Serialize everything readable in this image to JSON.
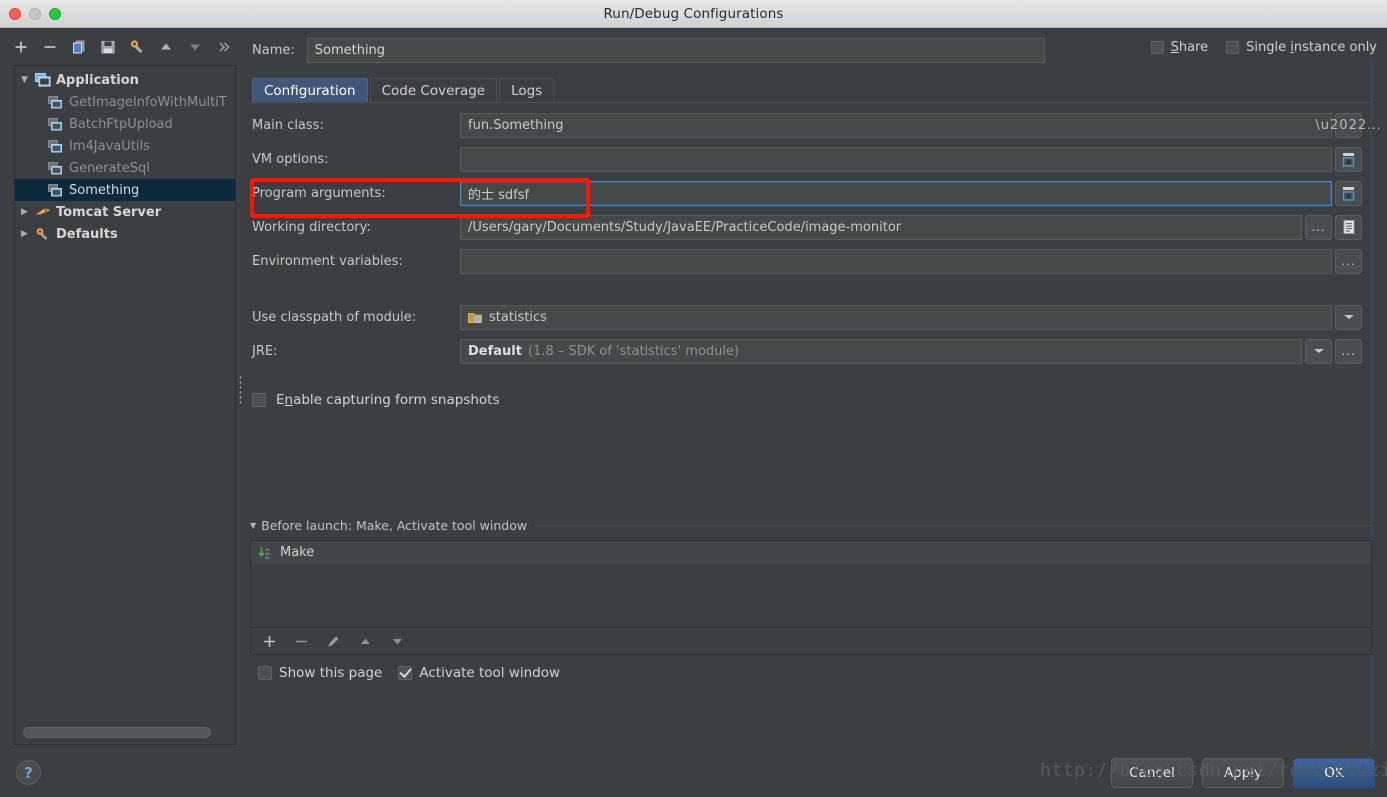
{
  "window": {
    "title": "Run/Debug Configurations",
    "traffic_lights": [
      "close",
      "minimize",
      "zoom"
    ]
  },
  "left_toolbar": {
    "items": [
      {
        "icon": "plus-icon",
        "label": "+"
      },
      {
        "icon": "minus-icon",
        "label": "−"
      },
      {
        "icon": "copy-icon",
        "label": "Copy"
      },
      {
        "icon": "save-icon",
        "label": "Save"
      },
      {
        "icon": "settings-wrench-icon",
        "label": "Edit defaults"
      },
      {
        "icon": "move-up-icon",
        "label": "Move Up"
      },
      {
        "icon": "move-down-icon",
        "label": "Move Down"
      },
      {
        "icon": "chevron-double-right-icon",
        "label": "»"
      }
    ]
  },
  "tree": {
    "nodes": [
      {
        "label": "Application",
        "level": 0,
        "expanded": true,
        "icon": "application-icon",
        "selected": false
      },
      {
        "label": "GetImageInfoWithMultiT",
        "level": 1,
        "icon": "run-config-icon",
        "selected": false
      },
      {
        "label": "BatchFtpUpload",
        "level": 1,
        "icon": "run-config-icon",
        "selected": false
      },
      {
        "label": "Im4JavaUtils",
        "level": 1,
        "icon": "run-config-icon",
        "selected": false
      },
      {
        "label": "GenerateSql",
        "level": 1,
        "icon": "run-config-icon",
        "selected": false
      },
      {
        "label": "Something",
        "level": 1,
        "icon": "run-config-icon",
        "selected": true
      },
      {
        "label": "Tomcat Server",
        "level": 0,
        "expanded": false,
        "icon": "tomcat-icon",
        "selected": false
      },
      {
        "label": "Defaults",
        "level": 0,
        "expanded": false,
        "icon": "defaults-wrench-icon",
        "selected": false
      }
    ]
  },
  "header": {
    "name_label": "Name:",
    "name_value": "Something",
    "share_label_pre": "S",
    "share_label_post": "hare",
    "share_checked": false,
    "single_instance_pre": "Single ",
    "single_instance_mn": "i",
    "single_instance_post": "nstance only",
    "single_instance_checked": false
  },
  "tabs": [
    {
      "label": "Configuration",
      "active": true
    },
    {
      "label": "Code Coverage",
      "active": false
    },
    {
      "label": "Logs",
      "active": false
    }
  ],
  "form": {
    "main_class": {
      "label": "Main class:",
      "value": "fun.Something",
      "browse": "..."
    },
    "vm_options": {
      "label": "VM options:",
      "value": "",
      "expand_icon": "expand-field-icon"
    },
    "program_arguments": {
      "label": "Program arguments:",
      "value": "的士  sdfsf",
      "expand_icon": "expand-field-icon",
      "focused": true,
      "highlighted": true
    },
    "working_directory": {
      "label": "Working directory:",
      "value": "/Users/gary/Documents/Study/JavaEE/PracticeCode/image-monitor",
      "browse": "...",
      "macros_icon": "macros-icon"
    },
    "environment_variables": {
      "label": "Environment variables:",
      "value": "",
      "browse": "..."
    },
    "classpath_module": {
      "label": "Use classpath of module:",
      "value": "statistics",
      "icon": "module-folder-icon",
      "dropdown": true
    },
    "jre": {
      "label": "JRE:",
      "value_bold": "Default",
      "value_rest": "(1.8 – SDK of 'statistics' module)",
      "dropdown": true,
      "browse": "..."
    },
    "form_snapshots": {
      "label_pre": "E",
      "label_mn": "n",
      "label_post": "able capturing form snapshots",
      "checked": false
    }
  },
  "before_launch": {
    "header": "Before launch: Make, Activate tool window",
    "items": [
      {
        "label": "Make",
        "icon": "make-build-icon"
      }
    ],
    "toolbar": [
      {
        "icon": "plus-icon",
        "label": "+"
      },
      {
        "icon": "minus-icon",
        "label": "−"
      },
      {
        "icon": "pencil-edit-icon",
        "label": "Edit"
      },
      {
        "icon": "move-up-icon",
        "label": "Up"
      },
      {
        "icon": "move-down-icon",
        "label": "Down"
      }
    ],
    "show_this_page": {
      "label": "Show this page",
      "checked": false
    },
    "activate_tool_window": {
      "label": "Activate tool window",
      "checked": true
    }
  },
  "footer": {
    "help_label": "?",
    "cancel_label": "Cancel",
    "apply_label": "Apply",
    "ok_label": "OK",
    "watermark": "http://blog.csdn.net/revitalizing"
  }
}
